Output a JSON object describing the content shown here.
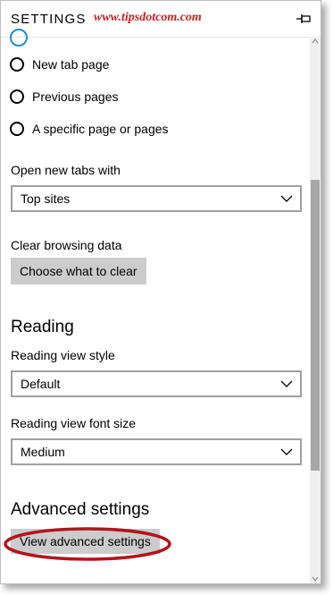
{
  "panel": {
    "title": "SETTINGS",
    "watermark": "www.tipsdotcom.com"
  },
  "startup": {
    "options": [
      {
        "label": "New tab page"
      },
      {
        "label": "Previous pages"
      },
      {
        "label": "A specific page or pages"
      }
    ]
  },
  "new_tabs": {
    "label": "Open new tabs with",
    "value": "Top sites"
  },
  "clear_browsing": {
    "label": "Clear browsing data",
    "button": "Choose what to clear"
  },
  "reading": {
    "heading": "Reading",
    "style_label": "Reading view style",
    "style_value": "Default",
    "font_label": "Reading view font size",
    "font_value": "Medium"
  },
  "advanced": {
    "heading": "Advanced settings",
    "button": "View advanced settings"
  },
  "colors": {
    "watermark": "#cc1f1f",
    "highlight_oval": "#b0151b",
    "accent": "#1f8fd6"
  },
  "icons": {
    "pin": "pin-icon",
    "dropdown": "chevron-down-icon"
  }
}
